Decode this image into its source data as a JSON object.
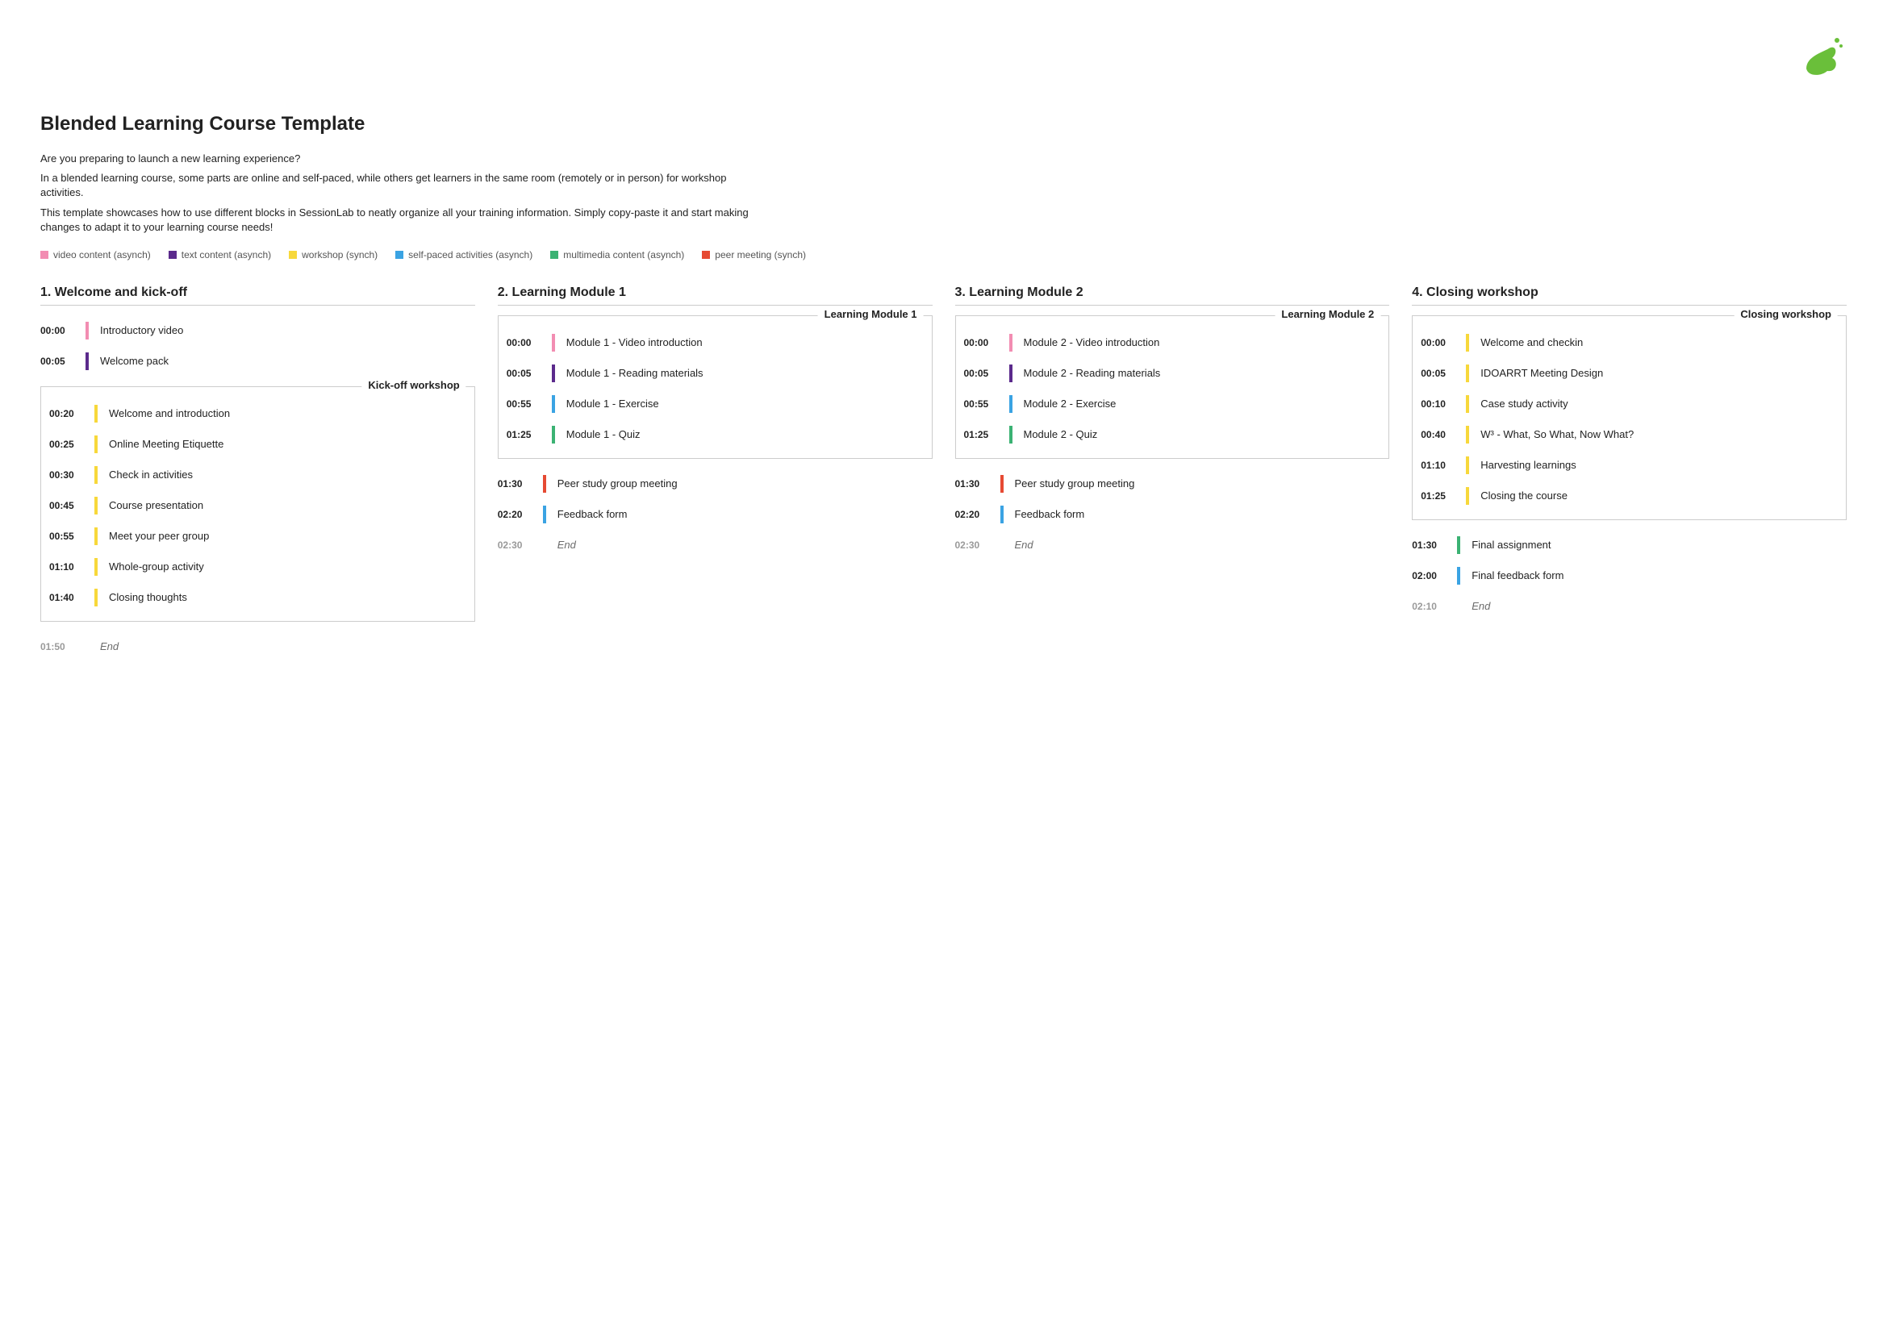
{
  "title": "Blended Learning Course Template",
  "intro": [
    "Are you preparing to launch a new learning experience?",
    "In a blended learning course, some parts are online and self-paced, while others get learners in the same room (remotely or in person) for workshop activities.",
    "This template showcases how to use different blocks in SessionLab to neatly organize all your training information. Simply copy-paste it and start making changes to adapt it to your learning course needs!"
  ],
  "legend": [
    {
      "label": "video content (asynch)",
      "color": "#f28db2"
    },
    {
      "label": "text content (asynch)",
      "color": "#5b2a8c"
    },
    {
      "label": "workshop (synch)",
      "color": "#f7d83b"
    },
    {
      "label": "self-paced activities (asynch)",
      "color": "#3aa3e3"
    },
    {
      "label": "multimedia content (asynch)",
      "color": "#3bb273"
    },
    {
      "label": "peer meeting (synch)",
      "color": "#e64a33"
    }
  ],
  "columns": [
    {
      "title": "1. Welcome and kick-off",
      "blocks": [
        {
          "type": "rows",
          "rows": [
            {
              "time": "00:00",
              "color": "#f28db2",
              "label": "Introductory video"
            },
            {
              "time": "00:05",
              "color": "#5b2a8c",
              "label": "Welcome pack"
            }
          ]
        },
        {
          "type": "group",
          "title": "Kick-off workshop",
          "rows": [
            {
              "time": "00:20",
              "color": "#f7d83b",
              "label": "Welcome and introduction"
            },
            {
              "time": "00:25",
              "color": "#f7d83b",
              "label": "Online Meeting Etiquette"
            },
            {
              "time": "00:30",
              "color": "#f7d83b",
              "label": "Check in activities"
            },
            {
              "time": "00:45",
              "color": "#f7d83b",
              "label": "Course presentation"
            },
            {
              "time": "00:55",
              "color": "#f7d83b",
              "label": "Meet your peer group"
            },
            {
              "time": "01:10",
              "color": "#f7d83b",
              "label": "Whole-group activity"
            },
            {
              "time": "01:40",
              "color": "#f7d83b",
              "label": "Closing thoughts"
            }
          ]
        },
        {
          "type": "end",
          "time": "01:50",
          "label": "End"
        }
      ]
    },
    {
      "title": "2. Learning Module 1",
      "blocks": [
        {
          "type": "group",
          "title": "Learning Module 1",
          "rows": [
            {
              "time": "00:00",
              "color": "#f28db2",
              "label": "Module 1 - Video introduction"
            },
            {
              "time": "00:05",
              "color": "#5b2a8c",
              "label": "Module 1 - Reading materials"
            },
            {
              "time": "00:55",
              "color": "#3aa3e3",
              "label": "Module 1 - Exercise"
            },
            {
              "time": "01:25",
              "color": "#3bb273",
              "label": "Module 1 - Quiz"
            }
          ]
        },
        {
          "type": "rows",
          "rows": [
            {
              "time": "01:30",
              "color": "#e64a33",
              "label": "Peer study group meeting"
            },
            {
              "time": "02:20",
              "color": "#3aa3e3",
              "label": "Feedback form"
            }
          ]
        },
        {
          "type": "end",
          "time": "02:30",
          "label": "End"
        }
      ]
    },
    {
      "title": "3. Learning Module 2",
      "blocks": [
        {
          "type": "group",
          "title": "Learning Module 2",
          "rows": [
            {
              "time": "00:00",
              "color": "#f28db2",
              "label": "Module 2 - Video introduction"
            },
            {
              "time": "00:05",
              "color": "#5b2a8c",
              "label": "Module 2 - Reading materials"
            },
            {
              "time": "00:55",
              "color": "#3aa3e3",
              "label": "Module 2 - Exercise"
            },
            {
              "time": "01:25",
              "color": "#3bb273",
              "label": "Module 2 - Quiz"
            }
          ]
        },
        {
          "type": "rows",
          "rows": [
            {
              "time": "01:30",
              "color": "#e64a33",
              "label": "Peer study group meeting"
            },
            {
              "time": "02:20",
              "color": "#3aa3e3",
              "label": "Feedback form"
            }
          ]
        },
        {
          "type": "end",
          "time": "02:30",
          "label": "End"
        }
      ]
    },
    {
      "title": "4. Closing workshop",
      "blocks": [
        {
          "type": "group",
          "title": "Closing workshop",
          "rows": [
            {
              "time": "00:00",
              "color": "#f7d83b",
              "label": "Welcome and checkin"
            },
            {
              "time": "00:05",
              "color": "#f7d83b",
              "label": "IDOARRT Meeting Design"
            },
            {
              "time": "00:10",
              "color": "#f7d83b",
              "label": "Case study activity"
            },
            {
              "time": "00:40",
              "color": "#f7d83b",
              "label": "W³ - What, So What, Now What?"
            },
            {
              "time": "01:10",
              "color": "#f7d83b",
              "label": "Harvesting learnings"
            },
            {
              "time": "01:25",
              "color": "#f7d83b",
              "label": "Closing the course"
            }
          ]
        },
        {
          "type": "rows",
          "rows": [
            {
              "time": "01:30",
              "color": "#3bb273",
              "label": "Final assignment"
            },
            {
              "time": "02:00",
              "color": "#3aa3e3",
              "label": "Final feedback form"
            }
          ]
        },
        {
          "type": "end",
          "time": "02:10",
          "label": "End"
        }
      ]
    }
  ]
}
